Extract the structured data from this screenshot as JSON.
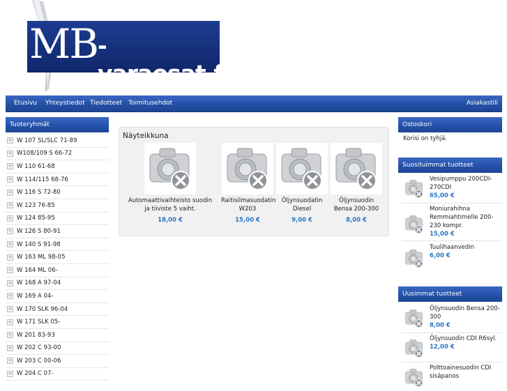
{
  "logo": {
    "mb": "MB",
    "rest": "-varaosat.fi"
  },
  "nav": {
    "items": [
      "Etusivu",
      "Yhteystiedot",
      "Tiedotteet",
      "Toimitusehdot"
    ],
    "right": "Asiakastili"
  },
  "categories": {
    "title": "Tuoteryhmät",
    "items": [
      "W 107 SL/SLC 71-89",
      "W108/109 S 66-72",
      "W 110 61-68",
      "W 114/115 68-76",
      "W 116 S 72-80",
      "W 123 76-85",
      "W 124 85-95",
      "W 126 S 80-91",
      "W 140 S 91-98",
      "W 163 ML 98-05",
      "W 164 ML 06-",
      "W 168 A 97-04",
      "W 169 A 04-",
      "W 170 SLK 96-04",
      "W 171 SLK 05-",
      "W 201 83-93",
      "W 202 C 93-00",
      "W 203 C 00-06",
      "W 204 C 07-"
    ]
  },
  "showcase": {
    "title": "Näyteikkuna",
    "products": [
      {
        "name": "Automaattivaihteisto suodin ja tiiviste 5 vaiht.",
        "price": "18,00 €"
      },
      {
        "name": "Raitisilmasuodatin W203",
        "price": "15,00 €"
      },
      {
        "name": "Öljynsuodatin Diesel",
        "price": "9,00 €"
      },
      {
        "name": "Öljynsuodin Bensa 200-300",
        "price": "8,00 €"
      }
    ]
  },
  "cart": {
    "title": "Ostoskori",
    "text": "Korisi on tyhjä."
  },
  "popular": {
    "title": "Suosituimmat tuotteet",
    "items": [
      {
        "name": "Vesipumppu 200CDI-270CDI",
        "price": "65,00 €"
      },
      {
        "name": "Moniurahihna Remmiahtimelle 200-230 kompr.",
        "price": "15,00 €"
      },
      {
        "name": "Tuulihaanvedin",
        "price": "6,00 €"
      }
    ]
  },
  "newest": {
    "title": "Uusimmat tuotteet",
    "items": [
      {
        "name": "Öljynsuodin Bensa 200-300",
        "price": "8,00 €"
      },
      {
        "name": "Öljynsuodin CDI R6syl.",
        "price": "12,00 €"
      },
      {
        "name": "Polttoainesuodin CDI sisäpanos",
        "price": ""
      }
    ]
  }
}
